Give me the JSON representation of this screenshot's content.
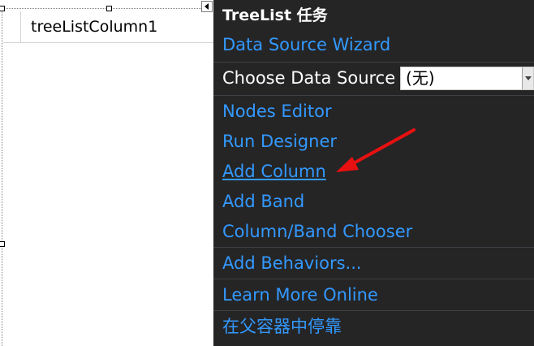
{
  "designer": {
    "column_header": "treeListColumn1"
  },
  "panel": {
    "title": "TreeList 任务",
    "items": {
      "data_source_wizard": "Data Source Wizard",
      "choose_data_source_label": "Choose Data Source",
      "choose_data_source_value": "(无)",
      "nodes_editor": "Nodes Editor",
      "run_designer": "Run Designer",
      "add_column": "Add Column",
      "add_band": "Add Band",
      "column_band_chooser": "Column/Band Chooser",
      "add_behaviors": "Add Behaviors...",
      "learn_more_online": "Learn More Online",
      "dock_in_parent": "在父容器中停靠"
    }
  },
  "colors": {
    "panel_background": "#252526",
    "link": "#3399ff",
    "separator": "#3f3f46",
    "annotation_arrow": "#e81010"
  },
  "icons": {
    "smart_tag": "smart-tag-arrow-icon",
    "dropdown": "chevron-down-icon",
    "annotation": "red-arrow-icon"
  }
}
